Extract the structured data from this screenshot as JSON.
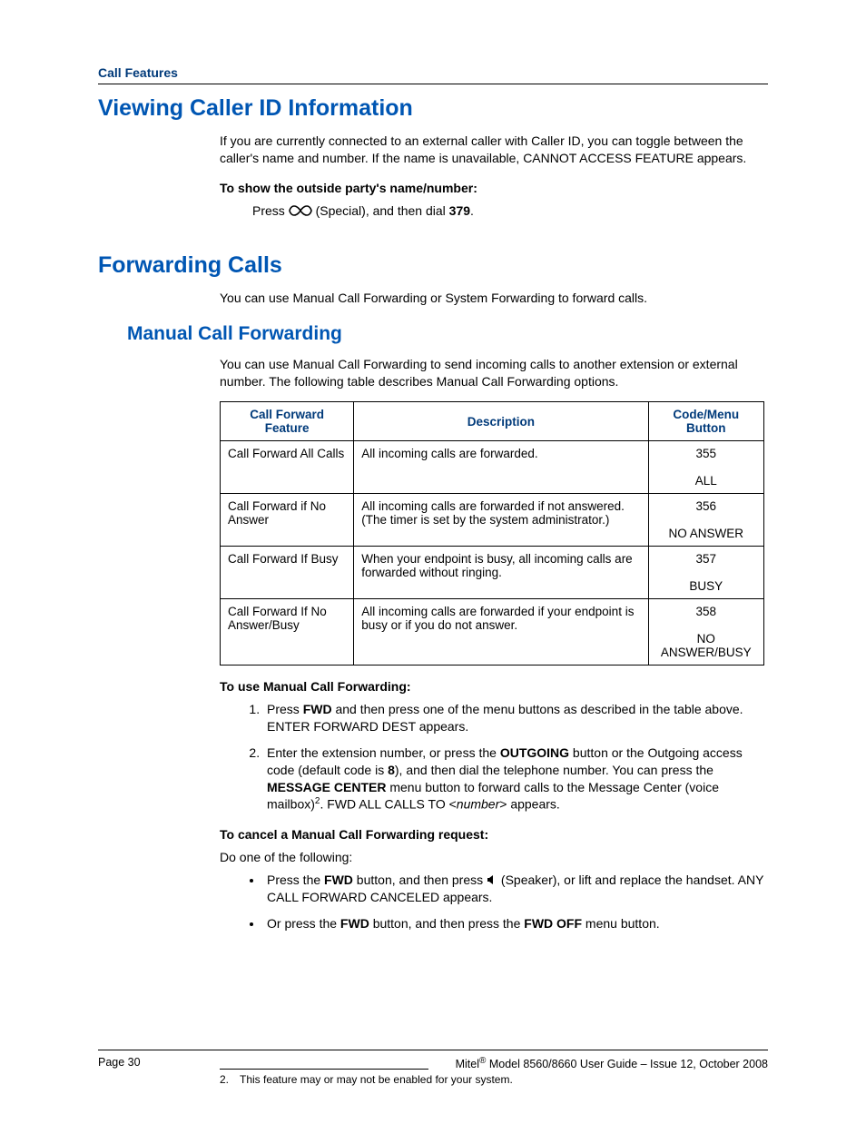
{
  "sectionLabel": "Call Features",
  "h1a": "Viewing Caller ID Information",
  "p1": "If you are currently connected to an external caller with Caller ID, you can toggle between the caller's name and number. If the name is unavailable, CANNOT ACCESS FEATURE appears.",
  "bp1": "To show the outside party's name/number:",
  "step1_a": "Press ",
  "step1_b": " (Special), and then dial ",
  "step1_code": "379",
  "step1_c": ".",
  "h1b": "Forwarding Calls",
  "p2": "You can use Manual Call Forwarding or System Forwarding to forward calls.",
  "h2a": "Manual Call Forwarding",
  "p3": "You can use Manual Call Forwarding to send incoming calls to another extension or external number. The following table describes Manual Call Forwarding options.",
  "table": {
    "headers": [
      "Call Forward Feature",
      "Description",
      "Code/Menu Button"
    ],
    "rows": [
      {
        "feature": "Call Forward All Calls",
        "desc": "All incoming calls are forwarded.",
        "code": "355",
        "menu": "ALL"
      },
      {
        "feature": "Call Forward if No Answer",
        "desc": "All incoming calls are forwarded if not answered. (The timer is set by the system administrator.)",
        "code": "356",
        "menu": "NO ANSWER"
      },
      {
        "feature": "Call Forward If Busy",
        "desc": "When your endpoint is busy, all incoming calls are forwarded without ringing.",
        "code": "357",
        "menu": "BUSY"
      },
      {
        "feature": "Call Forward If No Answer/Busy",
        "desc": "All incoming calls are forwarded if your endpoint is busy or if you do not answer.",
        "code": "358",
        "menu": "NO ANSWER/BUSY"
      }
    ]
  },
  "bp2": "To use Manual Call Forwarding:",
  "ol1": {
    "li1_a": "Press ",
    "li1_b": "FWD",
    "li1_c": " and then press one of the menu buttons as described in the table above. ENTER FORWARD DEST appears.",
    "li2_a": "Enter the extension number, or press the ",
    "li2_b": "OUTGOING",
    "li2_c": " button or the Outgoing access code (default code is ",
    "li2_d": "8",
    "li2_e": "), and then dial the telephone number. You can press the ",
    "li2_f": "MESSAGE CENTER",
    "li2_g": " menu button to forward calls to the Message Center (voice mailbox)",
    "li2_sup": "2",
    "li2_h": ". FWD ALL CALLS TO <",
    "li2_i": "number",
    "li2_j": "> appears."
  },
  "bp3": "To cancel a Manual Call Forwarding request:",
  "p4": "Do one of the following:",
  "ul1": {
    "li1_a": "Press the ",
    "li1_b": "FWD",
    "li1_c": " button, and then press ",
    "li1_d": " (Speaker), or lift and replace the handset. ANY CALL FORWARD CANCELED appears.",
    "li2_a": "Or press the ",
    "li2_b": "FWD",
    "li2_c": " button, and then press the ",
    "li2_d": "FWD OFF",
    "li2_e": " menu button."
  },
  "footnote": {
    "num": "2.",
    "text": "This feature may or may not be enabled for your system."
  },
  "footer": {
    "left": "Page 30",
    "right_a": "Mitel",
    "right_sup": "®",
    "right_b": " Model 8560/8660 User Guide – Issue 12, October 2008"
  }
}
